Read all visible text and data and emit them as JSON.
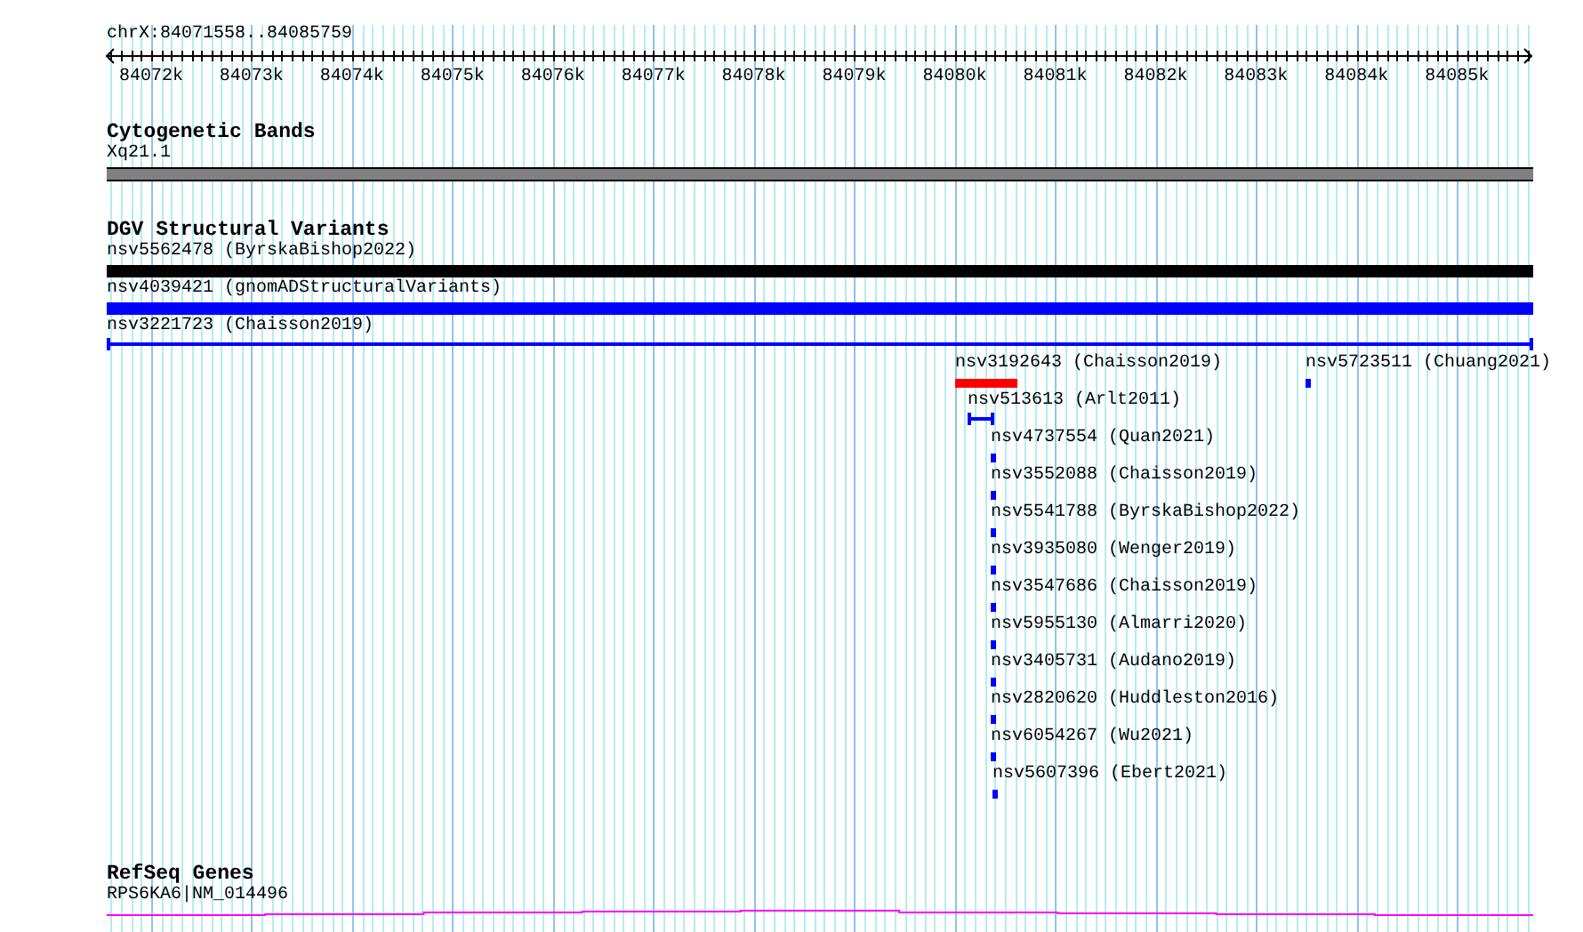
{
  "ruler": {
    "range": "chrX:84071558..84085759",
    "ticks": [
      "84072k",
      "84073k",
      "84074k",
      "84075k",
      "84076k",
      "84077k",
      "84078k",
      "84079k",
      "84080k",
      "84081k",
      "84082k",
      "84083k",
      "84084k",
      "84085k"
    ]
  },
  "tracks": [
    {
      "title": "Cytogenetic Bands",
      "kind": "bands",
      "rows": [
        {
          "features": [
            {
              "label": "Xq21.1",
              "kind": "band",
              "color": "#808080"
            }
          ]
        }
      ]
    },
    {
      "title": "DGV Structural Variants",
      "kind": "variants",
      "rows": [
        {
          "features": [
            {
              "label": "nsv5562478 (ByrskaBishop2022)",
              "kind": "bar",
              "color": "#000000"
            }
          ]
        },
        {
          "features": [
            {
              "label": "nsv4039421 (gnomADStructuralVariants)",
              "kind": "bar",
              "color": "#0000ff"
            }
          ]
        },
        {
          "features": [
            {
              "label": "nsv3221723 (Chaisson2019)",
              "kind": "span",
              "color": "#0000ff"
            }
          ]
        },
        {
          "features": [
            {
              "label": "nsv3192643 (Chaisson2019)",
              "kind": "bar",
              "color": "#ff0000"
            },
            {
              "label": "nsv5723511 (Chuang2021)",
              "kind": "bar",
              "color": "#0000ff"
            }
          ]
        },
        {
          "features": [
            {
              "label": "nsv513613 (Arlt2011)",
              "kind": "span",
              "color": "#0000ff"
            }
          ]
        },
        {
          "features": [
            {
              "label": "nsv4737554 (Quan2021)",
              "kind": "bar",
              "color": "#0000ff"
            }
          ]
        },
        {
          "features": [
            {
              "label": "nsv3552088 (Chaisson2019)",
              "kind": "bar",
              "color": "#0000ff"
            }
          ]
        },
        {
          "features": [
            {
              "label": "nsv5541788 (ByrskaBishop2022)",
              "kind": "bar",
              "color": "#0000ff"
            }
          ]
        },
        {
          "features": [
            {
              "label": "nsv3935080 (Wenger2019)",
              "kind": "bar",
              "color": "#0000ff"
            }
          ]
        },
        {
          "features": [
            {
              "label": "nsv3547686 (Chaisson2019)",
              "kind": "bar",
              "color": "#0000ff"
            }
          ]
        },
        {
          "features": [
            {
              "label": "nsv5955130 (Almarri2020)",
              "kind": "bar",
              "color": "#0000ff"
            }
          ]
        },
        {
          "features": [
            {
              "label": "nsv3405731 (Audano2019)",
              "kind": "bar",
              "color": "#0000ff"
            }
          ]
        },
        {
          "features": [
            {
              "label": "nsv2820620 (Huddleston2016)",
              "kind": "bar",
              "color": "#0000ff"
            }
          ]
        },
        {
          "features": [
            {
              "label": "nsv6054267 (Wu2021)",
              "kind": "bar",
              "color": "#0000ff"
            }
          ]
        },
        {
          "features": [
            {
              "label": "nsv5607396 (Ebert2021)",
              "kind": "bar",
              "color": "#0000ff"
            }
          ]
        }
      ]
    },
    {
      "title": "RefSeq Genes",
      "kind": "genes",
      "rows": [
        {
          "features": [
            {
              "label": "RPS6KA6|NM_014496",
              "kind": "gene",
              "color": "#ff00ff"
            }
          ]
        }
      ]
    }
  ]
}
